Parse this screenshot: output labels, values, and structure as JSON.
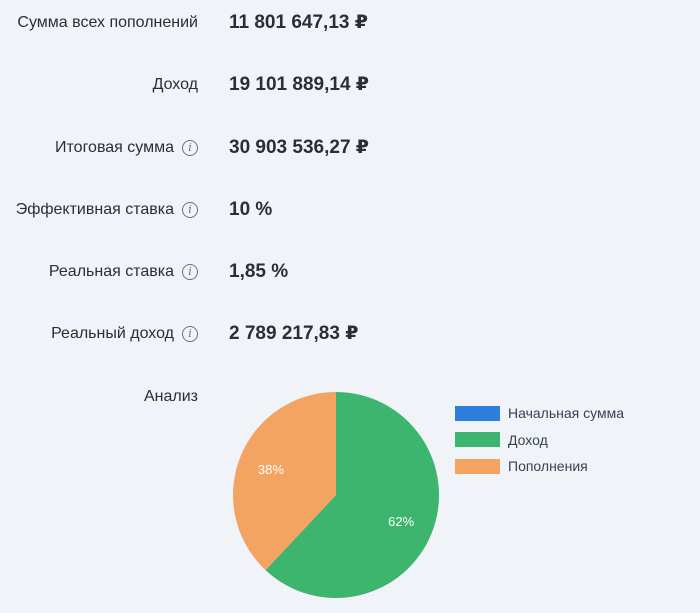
{
  "rows": [
    {
      "label": "Сумма всех пополнений",
      "value": "11 801 647,13 ₽",
      "has_info": false
    },
    {
      "label": "Доход",
      "value": "19 101 889,14 ₽",
      "has_info": false
    },
    {
      "label": "Итоговая сумма",
      "value": "30 903 536,27 ₽",
      "has_info": true
    },
    {
      "label": "Эффективная ставка",
      "value": "10 %",
      "has_info": true
    },
    {
      "label": "Реальная ставка",
      "value": "1,85 %",
      "has_info": true
    },
    {
      "label": "Реальный доход",
      "value": "2 789 217,83 ₽",
      "has_info": true
    }
  ],
  "info_icon_glyph": "i",
  "analysis": {
    "label": "Анализ"
  },
  "chart_data": {
    "type": "pie",
    "slices": [
      {
        "name": "Начальная сумма",
        "value": 0,
        "label": "",
        "color": "#2e7fdc"
      },
      {
        "name": "Доход",
        "value": 62,
        "label": "62%",
        "color": "#3db56f"
      },
      {
        "name": "Пополнения",
        "value": 38,
        "label": "38%",
        "color": "#f4a462"
      }
    ],
    "legend_position": "right"
  }
}
